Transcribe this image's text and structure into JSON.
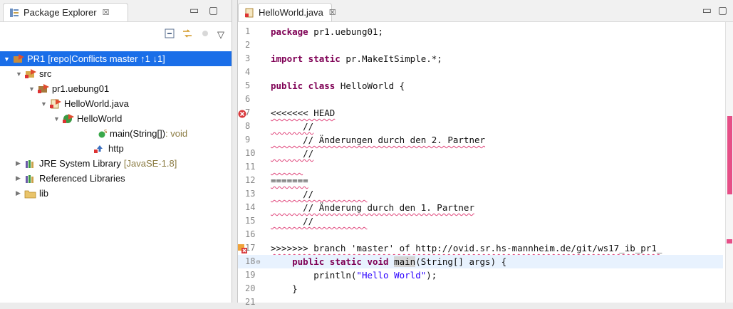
{
  "explorer": {
    "tab_title": "Package Explorer",
    "tree": [
      {
        "label": "PR1",
        "deco": " [repo|Conflicts master ↑1 ↓1]"
      },
      {
        "label": "src"
      },
      {
        "label": "pr1.uebung01"
      },
      {
        "label": "HelloWorld.java"
      },
      {
        "label": "HelloWorld"
      },
      {
        "label": "main(String[])",
        "suffix": " : void"
      },
      {
        "label": "http"
      },
      {
        "label": "JRE System Library",
        "deco": " [JavaSE-1.8]"
      },
      {
        "label": "Referenced Libraries"
      },
      {
        "label": "lib"
      }
    ]
  },
  "editor": {
    "tab_title": "HelloWorld.java",
    "lines": [
      {
        "n": "1",
        "t": "package pr1.uebung01;"
      },
      {
        "n": "2",
        "t": ""
      },
      {
        "n": "3",
        "t": "import static pr.MakeItSimple.*;"
      },
      {
        "n": "4",
        "t": ""
      },
      {
        "n": "5",
        "t": "public class HelloWorld {"
      },
      {
        "n": "6",
        "t": ""
      },
      {
        "n": "7",
        "t": "<<<<<<< HEAD"
      },
      {
        "n": "8",
        "t": "      //"
      },
      {
        "n": "9",
        "t": "      // Änderungen durch den 2. Partner"
      },
      {
        "n": "10",
        "t": "      //"
      },
      {
        "n": "11",
        "t": "      "
      },
      {
        "n": "12",
        "t": "======="
      },
      {
        "n": "13",
        "t": "      //          "
      },
      {
        "n": "14",
        "t": "      // Änderung durch den 1. Partner"
      },
      {
        "n": "15",
        "t": "      //          "
      },
      {
        "n": "16",
        "t": ""
      },
      {
        "n": "17",
        "t": ">>>>>>> branch 'master' of http://ovid.sr.hs-mannheim.de/git/ws17_ib_pr1_"
      },
      {
        "n": "18",
        "t": "    public static void main(String[] args) {"
      },
      {
        "n": "19",
        "t": "        println(\"Hello World\");"
      },
      {
        "n": "20",
        "t": "    }"
      },
      {
        "n": "21",
        "t": ""
      }
    ]
  }
}
